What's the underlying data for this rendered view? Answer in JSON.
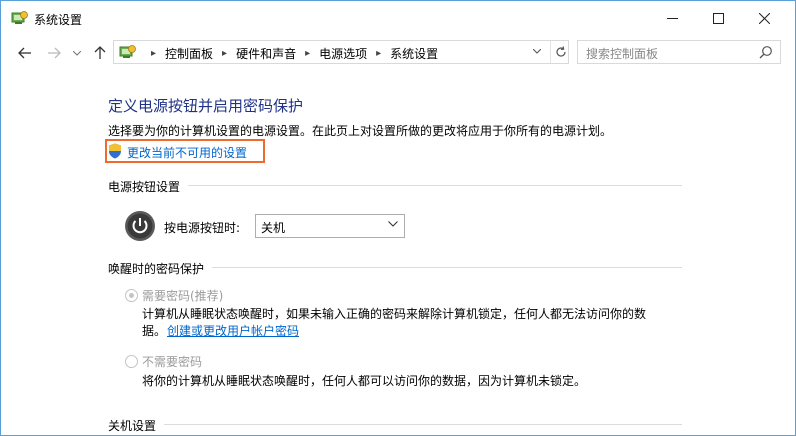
{
  "window": {
    "title": "系统设置",
    "controls": {
      "minimize": "—",
      "maximize": "☐",
      "close": "✕"
    }
  },
  "nav": {
    "back_icon": "arrow-left-icon",
    "forward_icon": "arrow-right-icon",
    "recent_icon": "chevron-down-icon",
    "up_icon": "arrow-up-icon"
  },
  "address": {
    "crumbs": [
      "控制面板",
      "硬件和声音",
      "电源选项",
      "系统设置"
    ],
    "refresh_icon": "refresh-icon"
  },
  "search": {
    "placeholder": "搜索控制面板"
  },
  "main": {
    "title": "定义电源按钮并启用密码保护",
    "description": "选择要为你的计算机设置的电源设置。在此页上对设置所做的更改将应用于你所有的电源计划。",
    "change_link": "更改当前不可用的设置",
    "power_section": {
      "heading": "电源按钮设置",
      "label": "按电源按钮时:",
      "selected": "关机"
    },
    "password_section": {
      "heading": "唤醒时的密码保护",
      "options": [
        {
          "label": "需要密码(推荐)",
          "checked": true,
          "description_line1": "计算机从睡眠状态唤醒时，如果未输入正确的密码来解除计算机锁定，任何人都无法访问你的数",
          "description_line2": "据。",
          "link": "创建或更改用户帐户密码"
        },
        {
          "label": "不需要密码",
          "checked": false,
          "description_line1": "将你的计算机从睡眠状态唤醒时，任何人都可以访问你的数据，因为计算机未锁定。"
        }
      ]
    },
    "shutdown_section": {
      "heading": "关机设置"
    }
  },
  "colors": {
    "title_blue": "#1e3287",
    "link_blue": "#0066cc",
    "highlight_orange": "#ec6b2d",
    "window_border": "#5aa0d8"
  }
}
